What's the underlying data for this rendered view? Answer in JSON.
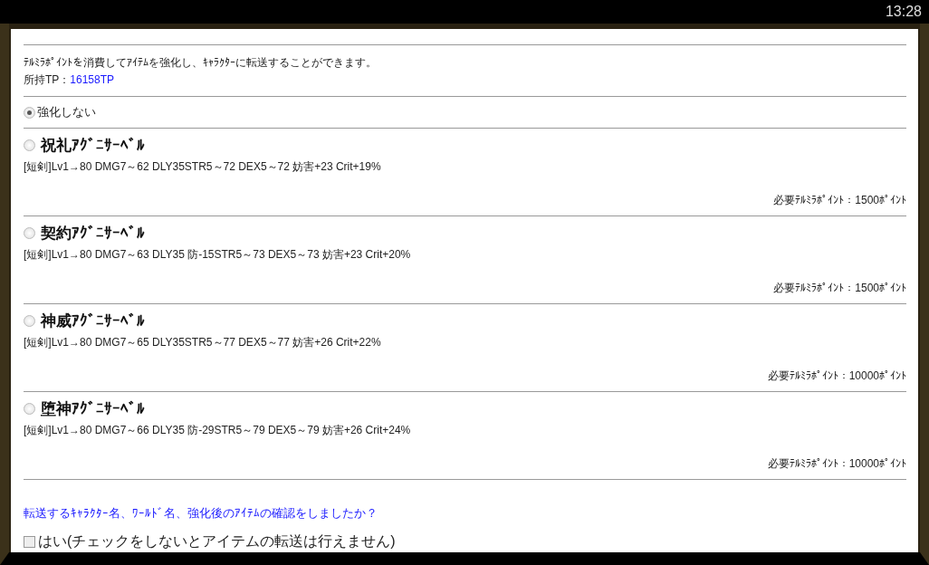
{
  "status_bar": {
    "time": "13:28"
  },
  "intro": {
    "text": "ﾃﾙﾐﾗﾎﾟｲﾝﾄを消費してｱｲﾃﾑを強化し、ｷｬﾗｸﾀｰに転送することができます。",
    "tp_label": "所持TP：",
    "tp_value": "16158TP"
  },
  "options": [
    {
      "kind": "none",
      "selected": true,
      "label": "強化しない"
    },
    {
      "kind": "item",
      "selected": false,
      "label": "祝礼ｱｸﾞﾆｻｰﾍﾞﾙ",
      "stats": "[短剣]Lv1→80 DMG7～62 DLY35STR5～72 DEX5～72 妨害+23 Crit+19%",
      "cost": "必要ﾃﾙﾐﾗﾎﾟｲﾝﾄ：1500ﾎﾟｲﾝﾄ"
    },
    {
      "kind": "item",
      "selected": false,
      "label": "契約ｱｸﾞﾆｻｰﾍﾞﾙ",
      "stats": "[短剣]Lv1→80 DMG7～63 DLY35 防-15STR5～73 DEX5～73 妨害+23 Crit+20%",
      "cost": "必要ﾃﾙﾐﾗﾎﾟｲﾝﾄ：1500ﾎﾟｲﾝﾄ"
    },
    {
      "kind": "item",
      "selected": false,
      "label": "神威ｱｸﾞﾆｻｰﾍﾞﾙ",
      "stats": "[短剣]Lv1→80 DMG7～65 DLY35STR5～77 DEX5～77 妨害+26 Crit+22%",
      "cost": "必要ﾃﾙﾐﾗﾎﾟｲﾝﾄ：10000ﾎﾟｲﾝﾄ"
    },
    {
      "kind": "item",
      "selected": false,
      "label": "堕神ｱｸﾞﾆｻｰﾍﾞﾙ",
      "stats": "[短剣]Lv1→80 DMG7～66 DLY35 防-29STR5～79 DEX5～79 妨害+26 Crit+24%",
      "cost": "必要ﾃﾙﾐﾗﾎﾟｲﾝﾄ：10000ﾎﾟｲﾝﾄ"
    }
  ],
  "confirm": {
    "question": "転送するｷｬﾗｸﾀｰ名、ﾜｰﾙﾄﾞ名、強化後のｱｲﾃﾑの確認をしましたか？",
    "checkbox_label": "はい(チェックをしないとアイテムの転送は行えません)",
    "checked": false
  }
}
